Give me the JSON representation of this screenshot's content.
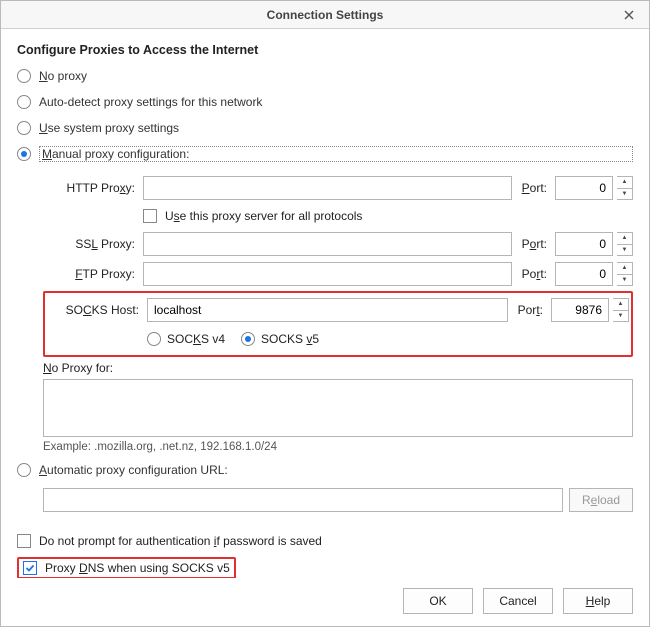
{
  "window": {
    "title": "Connection Settings"
  },
  "heading": "Configure Proxies to Access the Internet",
  "modes": {
    "no_proxy": "No proxy",
    "auto_detect": "Auto-detect proxy settings for this network",
    "use_system": "Use system proxy settings",
    "manual": "Manual proxy configuration:",
    "auto_url": "Automatic proxy configuration URL:"
  },
  "labels": {
    "http_proxy": "HTTP Proxy:",
    "ssl_proxy": "SSL Proxy:",
    "ftp_proxy": "FTP Proxy:",
    "socks_host": "SOCKS Host:",
    "port": "Port:",
    "use_all": "Use this proxy server for all protocols",
    "socks_v4": "SOCKS v4",
    "socks_v5": "SOCKS v5",
    "no_proxy_for": "No Proxy for:",
    "example": "Example: .mozilla.org, .net.nz, 192.168.1.0/24",
    "reload": "Reload",
    "no_prompt": "Do not prompt for authentication if password is saved",
    "proxy_dns": "Proxy DNS when using SOCKS v5"
  },
  "values": {
    "http_host": "",
    "http_port": "0",
    "ssl_host": "",
    "ssl_port": "0",
    "ftp_host": "",
    "ftp_port": "0",
    "socks_host": "localhost",
    "socks_port": "9876",
    "auto_url": ""
  },
  "buttons": {
    "ok": "OK",
    "cancel": "Cancel",
    "help": "Help"
  }
}
